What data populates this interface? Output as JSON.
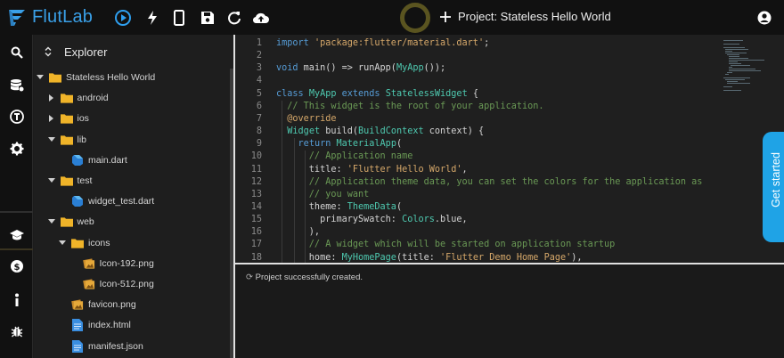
{
  "app": {
    "name": "FlutLab",
    "project_title": "Project: Stateless Hello World"
  },
  "toolbar": {
    "icons": [
      "run-icon",
      "hot-reload-icon",
      "device-icon",
      "save-icon",
      "refresh-icon",
      "upload-icon",
      "add-icon",
      "account-icon"
    ]
  },
  "rail": {
    "icons": [
      "search-icon",
      "database-icon",
      "template-icon",
      "settings-icon",
      "learn-icon",
      "money-icon",
      "info-icon",
      "bug-icon"
    ]
  },
  "explorer": {
    "title": "Explorer",
    "tree": [
      {
        "label": "Stateless Hello World",
        "type": "folder",
        "open": true
      },
      {
        "label": "android",
        "type": "folder",
        "open": false
      },
      {
        "label": "ios",
        "type": "folder",
        "open": false
      },
      {
        "label": "lib",
        "type": "folder",
        "open": true
      },
      {
        "label": "main.dart",
        "type": "dart"
      },
      {
        "label": "test",
        "type": "folder",
        "open": true
      },
      {
        "label": "widget_test.dart",
        "type": "dart"
      },
      {
        "label": "web",
        "type": "folder",
        "open": true
      },
      {
        "label": "icons",
        "type": "folder",
        "open": true
      },
      {
        "label": "Icon-192.png",
        "type": "image"
      },
      {
        "label": "Icon-512.png",
        "type": "image"
      },
      {
        "label": "favicon.png",
        "type": "image"
      },
      {
        "label": "index.html",
        "type": "file"
      },
      {
        "label": "manifest.json",
        "type": "file"
      }
    ]
  },
  "editor": {
    "line_numbers": [
      "1",
      "2",
      "3",
      "4",
      "5",
      "6",
      "7",
      "8",
      "9",
      "10",
      "11",
      "12",
      "13",
      "14",
      "15",
      "16",
      "17",
      "18"
    ],
    "lines": [
      [
        {
          "t": "import ",
          "c": "kw"
        },
        {
          "t": "'package:flutter/material.dart'",
          "c": "str"
        },
        {
          "t": ";",
          "c": ""
        }
      ],
      [],
      [
        {
          "t": "void ",
          "c": "kw"
        },
        {
          "t": "main() => runApp(",
          "c": ""
        },
        {
          "t": "MyApp",
          "c": "ty"
        },
        {
          "t": "());",
          "c": ""
        }
      ],
      [],
      [
        {
          "t": "class ",
          "c": "kw"
        },
        {
          "t": "MyApp ",
          "c": "ty"
        },
        {
          "t": "extends ",
          "c": "kw"
        },
        {
          "t": "StatelessWidget",
          "c": "ty"
        },
        {
          "t": " {",
          "c": ""
        }
      ],
      [
        {
          "t": "  // This widget is the root of your application.",
          "c": "cm"
        }
      ],
      [
        {
          "t": "  ",
          "c": ""
        },
        {
          "t": "@override",
          "c": "str"
        }
      ],
      [
        {
          "t": "  ",
          "c": ""
        },
        {
          "t": "Widget",
          "c": "ty"
        },
        {
          "t": " build(",
          "c": ""
        },
        {
          "t": "BuildContext",
          "c": "ty"
        },
        {
          "t": " context) {",
          "c": ""
        }
      ],
      [
        {
          "t": "    ",
          "c": ""
        },
        {
          "t": "return ",
          "c": "kw"
        },
        {
          "t": "MaterialApp",
          "c": "ty"
        },
        {
          "t": "(",
          "c": ""
        }
      ],
      [
        {
          "t": "      // Application name",
          "c": "cm"
        }
      ],
      [
        {
          "t": "      title: ",
          "c": ""
        },
        {
          "t": "'Flutter Hello World'",
          "c": "str"
        },
        {
          "t": ",",
          "c": ""
        }
      ],
      [
        {
          "t": "      // Application theme data, you can set the colors for the application as",
          "c": "cm"
        }
      ],
      [
        {
          "t": "      // you want",
          "c": "cm"
        }
      ],
      [
        {
          "t": "      theme: ",
          "c": ""
        },
        {
          "t": "ThemeData",
          "c": "ty"
        },
        {
          "t": "(",
          "c": ""
        }
      ],
      [
        {
          "t": "        primarySwatch: ",
          "c": ""
        },
        {
          "t": "Colors",
          "c": "ty"
        },
        {
          "t": ".blue,",
          "c": ""
        }
      ],
      [
        {
          "t": "      ),",
          "c": ""
        }
      ],
      [
        {
          "t": "      // A widget which will be started on application startup",
          "c": "cm"
        }
      ],
      [
        {
          "t": "      home: ",
          "c": ""
        },
        {
          "t": "MyHomePage",
          "c": "ty"
        },
        {
          "t": "(title: ",
          "c": ""
        },
        {
          "t": "'Flutter Demo Home Page'",
          "c": "str"
        },
        {
          "t": "),",
          "c": ""
        }
      ]
    ]
  },
  "console": {
    "message": "Project successfully created."
  },
  "get_started": {
    "label": "Get started"
  },
  "colors": {
    "accent": "#1fa3e6",
    "folder": "#f0b429",
    "dart": "#2a7fd4"
  }
}
